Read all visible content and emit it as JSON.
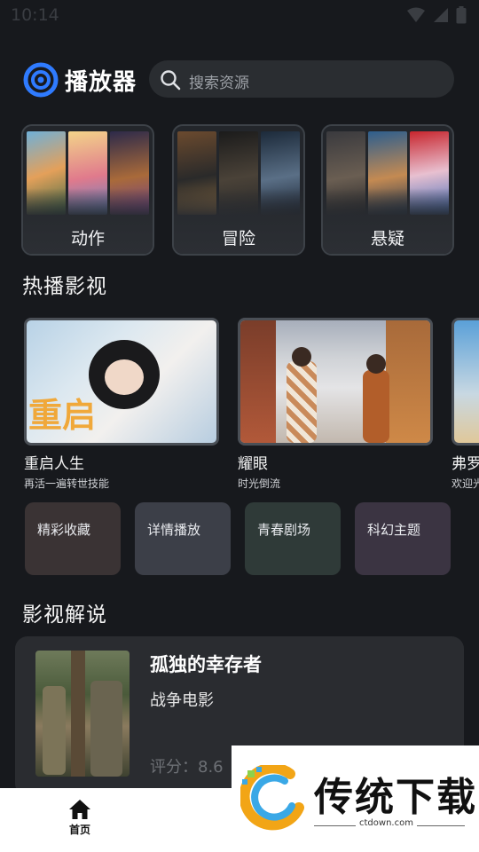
{
  "status_bar": {
    "time": "10:14"
  },
  "header": {
    "app_title": "播放器",
    "search_placeholder": "搜索资源"
  },
  "genres": [
    {
      "label": "动作"
    },
    {
      "label": "冒险"
    },
    {
      "label": "悬疑"
    }
  ],
  "hot_section": {
    "title": "热播影视",
    "items": [
      {
        "title": "重启人生",
        "subtitle": "再活一遍转世技能",
        "poster_text": "重启"
      },
      {
        "title": "耀眼",
        "subtitle": "时光倒流"
      },
      {
        "title": "弗罗",
        "subtitle": "欢迎光"
      }
    ]
  },
  "themes": [
    {
      "label": "精彩收藏",
      "color": "#3a3334"
    },
    {
      "label": "详情播放",
      "color": "#3c3f48"
    },
    {
      "label": "青春剧场",
      "color": "#2f3a38"
    },
    {
      "label": "科幻主题",
      "color": "#3b3442"
    }
  ],
  "explain_section": {
    "title": "影视解说",
    "card": {
      "title": "孤独的幸存者",
      "genre": "战争电影",
      "score": "评分：8.6"
    }
  },
  "tab_bar": {
    "home_label": "首页"
  },
  "watermark": {
    "text": "传统下载",
    "url": "ctdown.com"
  },
  "colors": {
    "accent": "#2f7bff",
    "background": "#17191d",
    "card": "#2a2c30"
  }
}
